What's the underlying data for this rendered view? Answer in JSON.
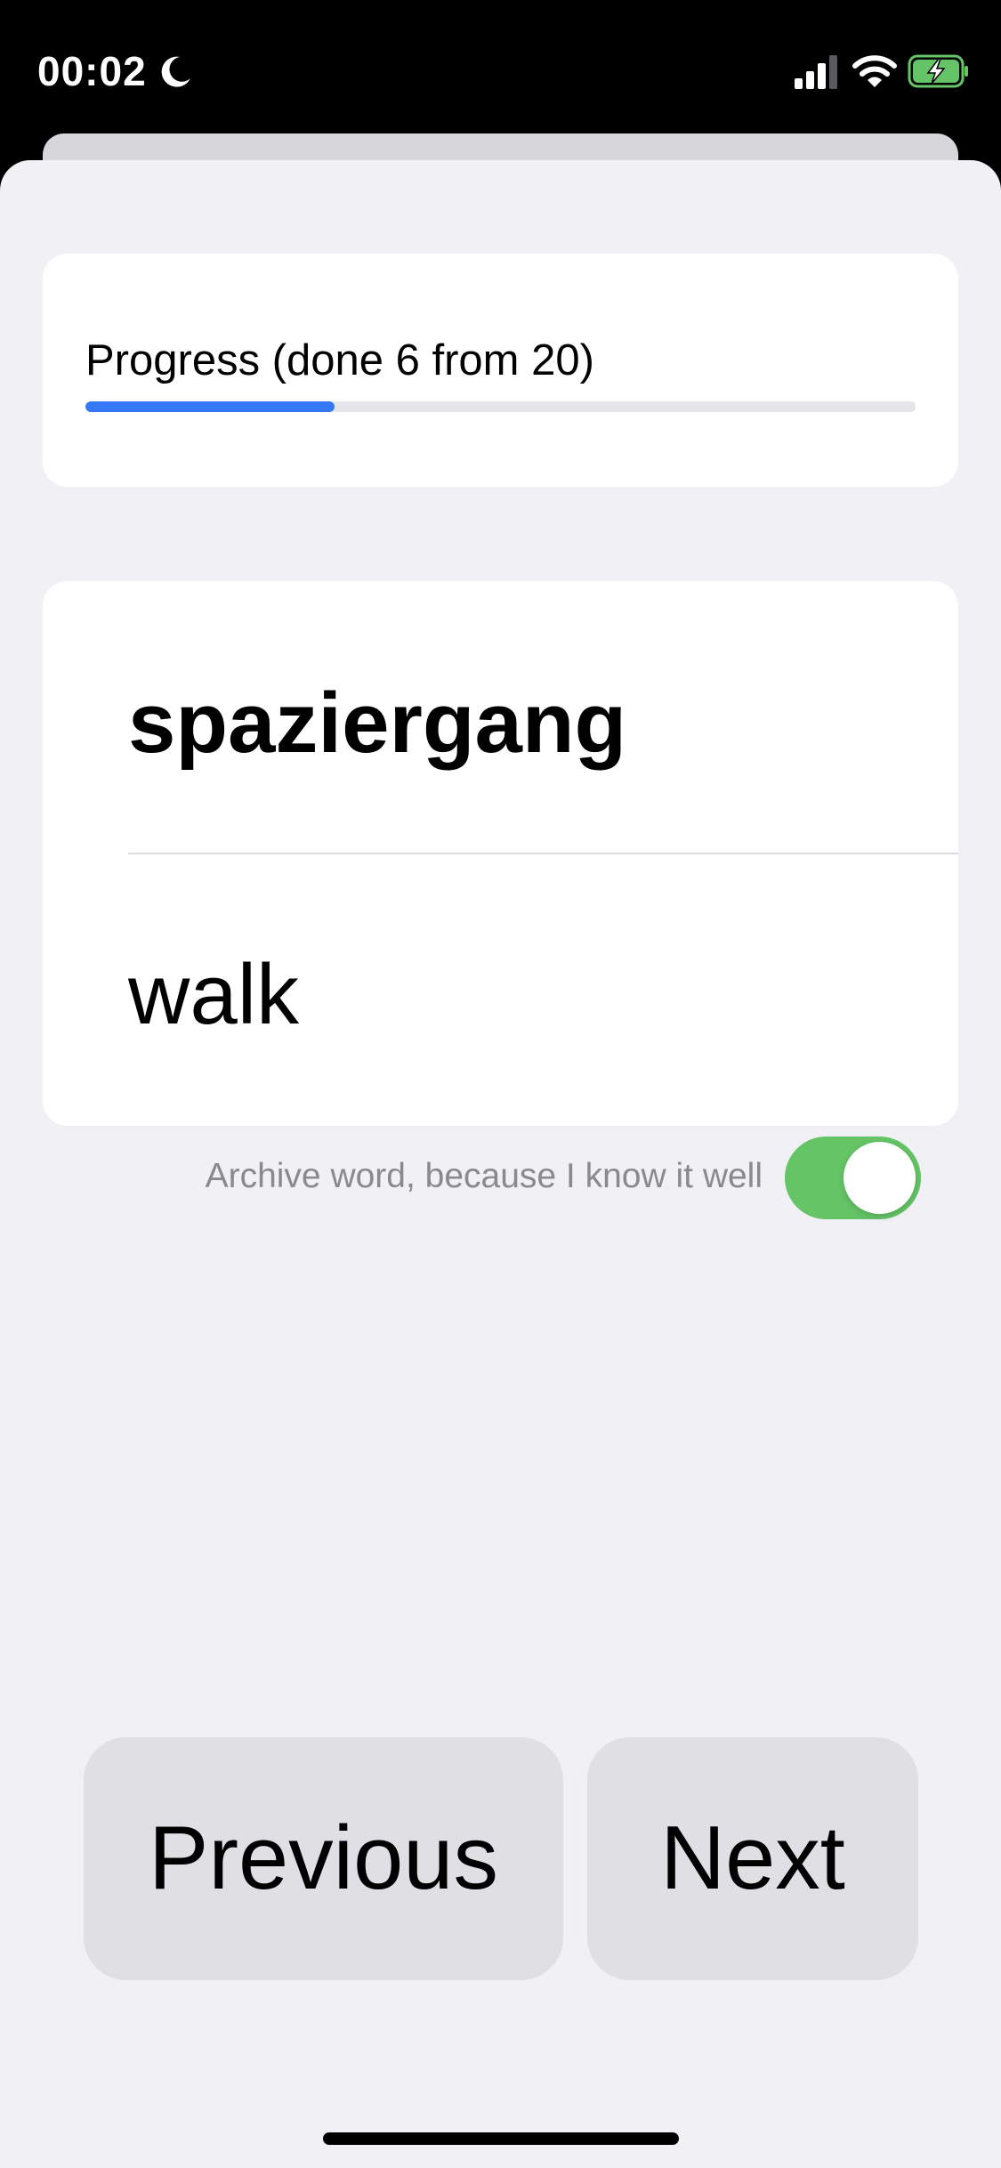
{
  "status_bar": {
    "time": "00:02",
    "focus_icon": "moon-icon",
    "signal_icon": "cellular-signal-icon",
    "wifi_icon": "wifi-icon",
    "battery_icon": "battery-charging-icon"
  },
  "progress": {
    "label": "Progress (done 6 from 20)",
    "done": 6,
    "total": 20,
    "fraction": 0.3,
    "fill_color": "#3478f6"
  },
  "card": {
    "term": "spaziergang",
    "translation": "walk"
  },
  "archive": {
    "label": "Archive word, because I know it well",
    "enabled": true,
    "on_color": "#65c466"
  },
  "buttons": {
    "previous_label": "Previous",
    "next_label": "Next"
  }
}
